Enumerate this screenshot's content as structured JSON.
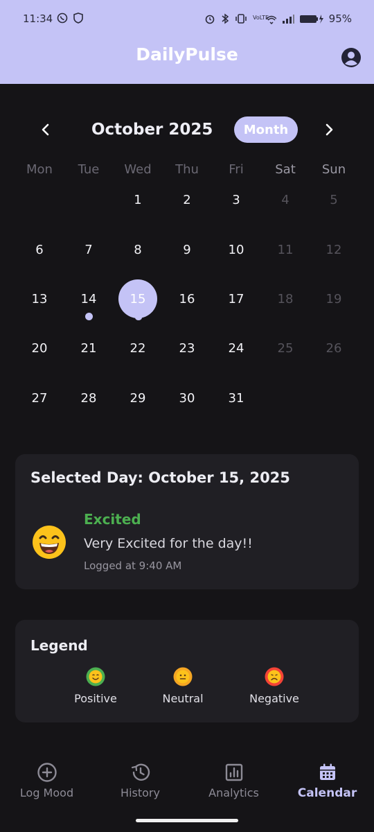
{
  "status_bar": {
    "time": "11:34",
    "battery": "95%"
  },
  "app_bar": {
    "title": "DailyPulse"
  },
  "calendar": {
    "month_title": "October 2025",
    "view_toggle": "Month",
    "weekdays": [
      "Mon",
      "Tue",
      "Wed",
      "Thu",
      "Fri",
      "Sat",
      "Sun"
    ],
    "days": [
      "1",
      "2",
      "3",
      "4",
      "5",
      "6",
      "7",
      "8",
      "9",
      "10",
      "11",
      "12",
      "13",
      "14",
      "15",
      "16",
      "17",
      "18",
      "19",
      "20",
      "21",
      "22",
      "23",
      "24",
      "25",
      "26",
      "27",
      "28",
      "29",
      "30",
      "31"
    ],
    "selected_day": "15",
    "marked_day": "14"
  },
  "selected_day_card": {
    "title": "Selected Day: October 15, 2025",
    "mood_label": "Excited",
    "note": "Very Excited for the day!!",
    "logged_at": "Logged at 9:40 AM"
  },
  "legend": {
    "title": "Legend",
    "items": [
      {
        "label": "Positive",
        "color": "#4caf50"
      },
      {
        "label": "Neutral",
        "color": "#f5a623"
      },
      {
        "label": "Negative",
        "color": "#f44336"
      }
    ]
  },
  "bottom_nav": {
    "items": [
      {
        "label": "Log Mood",
        "icon": "add-circle-icon"
      },
      {
        "label": "History",
        "icon": "history-icon"
      },
      {
        "label": "Analytics",
        "icon": "analytics-icon"
      },
      {
        "label": "Calendar",
        "icon": "calendar-icon"
      }
    ],
    "active": "Calendar"
  },
  "colors": {
    "accent": "#c4c3f6",
    "background": "#151417",
    "card": "#201f24",
    "positive": "#4caf50"
  }
}
